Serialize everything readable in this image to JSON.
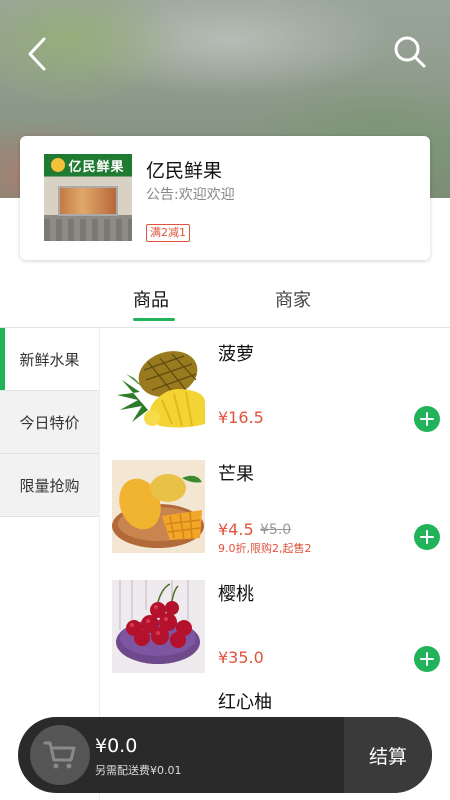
{
  "header": {
    "back_icon": "chevron-left-icon",
    "search_icon": "search-icon"
  },
  "store": {
    "name": "亿民鲜果",
    "notice": "公告:欢迎欢迎",
    "promo_badge": "满2减1",
    "photo_sign": "亿民鲜果"
  },
  "tabs": [
    {
      "label": "商品",
      "active": true
    },
    {
      "label": "商家",
      "active": false
    }
  ],
  "categories": [
    {
      "label": "新鲜水果",
      "active": true
    },
    {
      "label": "今日特价",
      "active": false
    },
    {
      "label": "限量抢购",
      "active": false
    }
  ],
  "products": [
    {
      "name": "菠萝",
      "price": "¥16.5"
    },
    {
      "name": "芒果",
      "price": "¥4.5",
      "original_price": "¥5.0",
      "note": "9.0折,限购2,起售2"
    },
    {
      "name": "樱桃",
      "price": "¥35.0"
    },
    {
      "name": "红心柚"
    }
  ],
  "cart": {
    "total": "¥0.0",
    "delivery_note": "另需配送费¥0.01",
    "checkout_label": "结算",
    "cart_icon": "shopping-cart-icon"
  },
  "colors": {
    "accent_green": "#22b35a",
    "price_red": "#e0533c",
    "cart_bar": "#2a2a2a"
  }
}
